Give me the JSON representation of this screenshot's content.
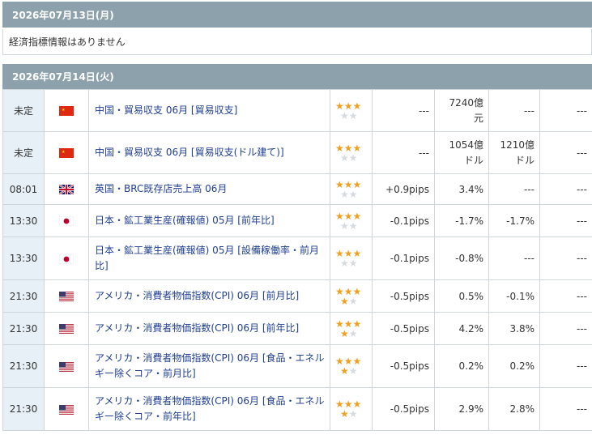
{
  "days": [
    {
      "date": "2026年07月13日(月)",
      "empty_message": "経済指標情報はありません"
    },
    {
      "date": "2026年07月14日(火)"
    }
  ],
  "rows": [
    {
      "time": "未定",
      "flag": "china-flag",
      "name": "中国・貿易収支 06月 [貿易収支]",
      "stars": 3,
      "impact": "---",
      "previous": "7240億元",
      "previous_l1": "7240億",
      "previous_l2": "元",
      "forecast": "---",
      "actual": "---"
    },
    {
      "time": "未定",
      "flag": "china-flag",
      "name": "中国・貿易収支 06月 [貿易収支(ドル建て)]",
      "stars": 3,
      "impact": "---",
      "previous": "1054億ドル",
      "previous_l1": "1054億",
      "previous_l2": "ドル",
      "forecast_l1": "1210億",
      "forecast_l2": "ドル",
      "forecast": "1210億ドル",
      "actual": "---"
    },
    {
      "time": "08:01",
      "flag": "uk-flag",
      "name": "英国・BRC既存店売上高 06月",
      "stars": 3,
      "impact": "+0.9pips",
      "previous": "3.4%",
      "forecast": "---",
      "actual": "---"
    },
    {
      "time": "13:30",
      "flag": "japan-flag",
      "name": "日本・鉱工業生産(確報値) 05月 [前年比]",
      "stars": 3,
      "impact": "-0.1pips",
      "previous": "-1.7%",
      "forecast": "-1.7%",
      "actual": "---"
    },
    {
      "time": "13:30",
      "flag": "japan-flag",
      "name": "日本・鉱工業生産(確報値) 05月 [設備稼働率・前月比]",
      "stars": 3,
      "impact": "-0.1pips",
      "previous": "-0.8%",
      "forecast": "---",
      "actual": "---"
    },
    {
      "time": "21:30",
      "flag": "us-flag",
      "name": "アメリカ・消費者物価指数(CPI) 06月 [前月比]",
      "stars": 4,
      "impact": "-0.5pips",
      "previous": "0.5%",
      "forecast": "-0.1%",
      "actual": "---"
    },
    {
      "time": "21:30",
      "flag": "us-flag",
      "name": "アメリカ・消費者物価指数(CPI) 06月 [前年比]",
      "stars": 4,
      "impact": "-0.5pips",
      "previous": "4.2%",
      "forecast": "3.8%",
      "actual": "---"
    },
    {
      "time": "21:30",
      "flag": "us-flag",
      "name": "アメリカ・消費者物価指数(CPI) 06月 [食品・エネルギー除くコア・前月比]",
      "stars": 4,
      "impact": "-0.5pips",
      "previous": "0.2%",
      "forecast": "0.2%",
      "actual": "---"
    },
    {
      "time": "21:30",
      "flag": "us-flag",
      "name": "アメリカ・消費者物価指数(CPI) 06月 [食品・エネルギー除くコア・前年比]",
      "stars": 4,
      "impact": "-0.5pips",
      "previous": "2.9%",
      "forecast": "2.8%",
      "actual": "---"
    }
  ],
  "star_glyph": "★",
  "colors": {
    "header_bg": "#8da1ad",
    "time_bg": "#e7f0f6",
    "link": "#1f3f8f",
    "star_on": "#f0a020",
    "star_off": "#d5dbe0"
  }
}
